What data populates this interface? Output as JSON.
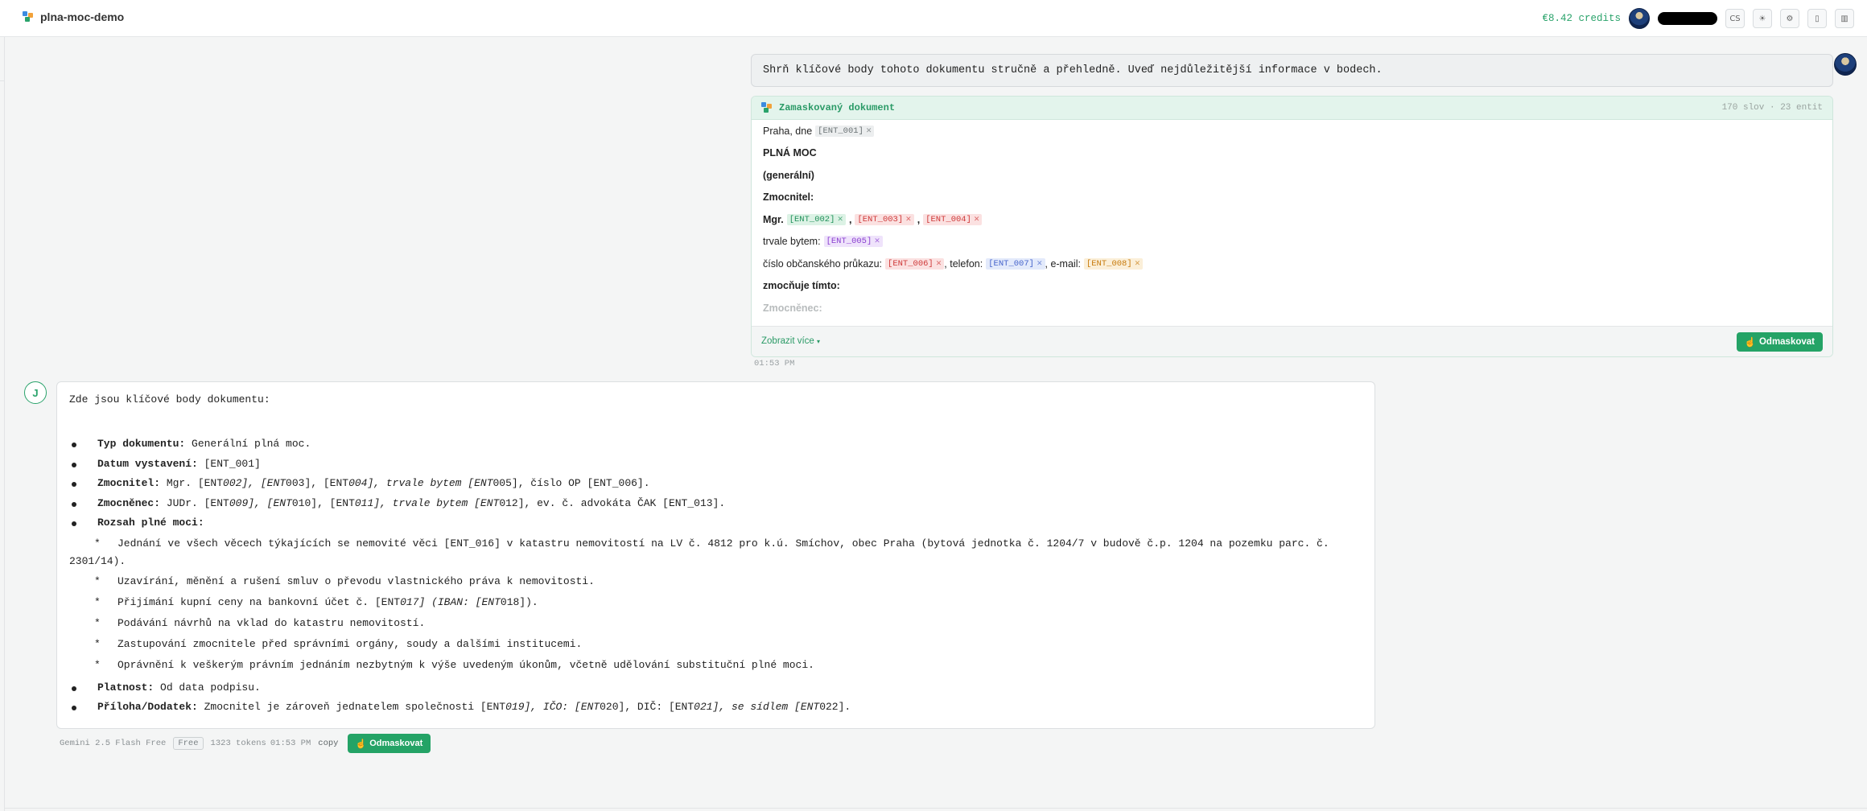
{
  "header": {
    "app_name": "plna-moc-demo",
    "credits": "€8.42 credits",
    "lang": "CS",
    "icons": [
      "sun-icon",
      "settings-icon",
      "document-icon",
      "trash-icon"
    ]
  },
  "user_message": {
    "text": "Shrň klíčové body tohoto dokumentu stručně a přehledně. Uveď nejdůležitější informace v bodech."
  },
  "masked_doc": {
    "title": "Zamaskovaný dokument",
    "meta": "170 slov · 23 entit",
    "lines": {
      "l1_text": "Praha, dne",
      "l1_ent": "[ENT_001]",
      "l2": "PLNÁ MOC",
      "l3": "(generální)",
      "l4": "Zmocnitel:",
      "l5_text": "Mgr.",
      "l5_ent1": "[ENT_002]",
      "l5_ent2": "[ENT_003]",
      "l5_ent3": "[ENT_004]",
      "l6_text": "trvale bytem:",
      "l6_ent": "[ENT_005]",
      "l7_text1": "číslo občanského průkazu:",
      "l7_ent1": "[ENT_006]",
      "l7_text2": ", telefon:",
      "l7_ent2": "[ENT_007]",
      "l7_text3": ", e-mail:",
      "l7_ent3": "[ENT_008]",
      "l8": "zmocňuje tímto:",
      "l9": "Zmocněnec:"
    },
    "show_more": "Zobrazit více",
    "unmask_label": "Odmaskovat",
    "time": "01:53 PM"
  },
  "assistant": {
    "avatar_letter": "J",
    "intro": "Zde jsou klíčové body dokumentu:",
    "typ_label": "Typ dokumentu:",
    "typ_value": " Generální plná moc.",
    "datum_label": "Datum vystavení:",
    "datum_value": " [ENT_001]",
    "zmocnitel_label": "Zmocnitel:",
    "zmocnitel_a": " Mgr. [ENT",
    "zmocnitel_b": "002], [ENT",
    "zmocnitel_c": "003], [ENT",
    "zmocnitel_d": "004], trvale bytem [ENT",
    "zmocnitel_e": "005], číslo OP [ENT_006].",
    "zmocnenec_label": "Zmocněnec:",
    "zmocnenec_a": " JUDr. [ENT",
    "zmocnenec_b": "009], [ENT",
    "zmocnenec_c": "010], [ENT",
    "zmocnenec_d": "011], trvale bytem [ENT",
    "zmocnenec_e": "012], ev. č. advokáta ČAK [ENT_013].",
    "rozsah_label": "Rozsah plné moci:",
    "rozsah_1a": "Jednání ve všech věcech týkajících se nemovité věci [ENT_016] v katastru nemovitostí na LV č. 4812 pro k.ú. Smíchov, obec Praha (bytová jednotka č. 1204/7 v budově č.p. 1204 na pozemku parc. č.",
    "rozsah_1b": "2301/14).",
    "rozsah_2": "Uzavírání, měnění a rušení smluv o převodu vlastnického práva k nemovitosti.",
    "rozsah_3a": "Přijímání kupní ceny na bankovní účet č. [ENT",
    "rozsah_3b": "017] (IBAN: [ENT",
    "rozsah_3c": "018]).",
    "rozsah_4": "Podávání návrhů na vklad do katastru nemovitostí.",
    "rozsah_5": "Zastupování zmocnitele před správními orgány, soudy a dalšími institucemi.",
    "rozsah_6": "Oprávnění k veškerým právním jednáním nezbytným k výše uvedeným úkonům, včetně udělování substituční plné moci.",
    "platnost_label": "Platnost:",
    "platnost_value": " Od data podpisu.",
    "priloha_label": "Příloha/Dodatek:",
    "priloha_a": " Zmocnitel je zároveň jednatelem společnosti [ENT",
    "priloha_b": "019], IČO: [ENT",
    "priloha_c": "020], DIČ: [ENT",
    "priloha_d": "021], se sídlem [ENT",
    "priloha_e": "022]."
  },
  "footer": {
    "model": "Gemini 2.5 Flash Free",
    "tier": "Free",
    "tokens": "1323 tokens",
    "time": "01:53 PM",
    "copy": "copy",
    "unmask": "Odmaskovat"
  },
  "colors": {
    "accent": "#24a366",
    "entity_green": "#21915a",
    "entity_red": "#cf3a3a",
    "entity_purple": "#8a3fd0",
    "entity_blue": "#4866cc",
    "entity_orange": "#c77b0e"
  }
}
